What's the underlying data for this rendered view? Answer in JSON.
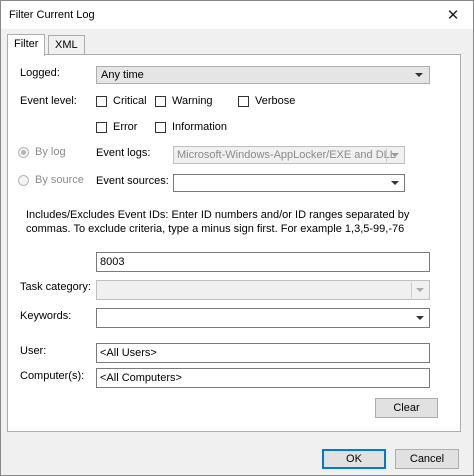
{
  "window": {
    "title": "Filter Current Log",
    "close_glyph": "✕"
  },
  "tabs": [
    {
      "label": "Filter"
    },
    {
      "label": "XML"
    }
  ],
  "logged": {
    "label": "Logged:",
    "value": "Any time"
  },
  "event_level": {
    "label": "Event level:",
    "options": [
      {
        "label": "Critical",
        "checked": false
      },
      {
        "label": "Warning",
        "checked": false
      },
      {
        "label": "Verbose",
        "checked": false
      },
      {
        "label": "Error",
        "checked": false
      },
      {
        "label": "Information",
        "checked": false
      }
    ]
  },
  "by_log": {
    "label": "By log",
    "selected": true
  },
  "by_source": {
    "label": "By source",
    "selected": false
  },
  "event_logs": {
    "label": "Event logs:",
    "value": "Microsoft-Windows-AppLocker/EXE and DLL"
  },
  "event_sources": {
    "label": "Event sources:",
    "value": ""
  },
  "event_ids": {
    "help": "Includes/Excludes Event IDs: Enter ID numbers and/or ID ranges separated by commas. To exclude criteria, type a minus sign first. For example 1,3,5-99,-76",
    "value": "8003"
  },
  "task_category": {
    "label": "Task category:",
    "value": ""
  },
  "keywords": {
    "label": "Keywords:",
    "value": ""
  },
  "user": {
    "label": "User:",
    "value": "<All Users>"
  },
  "computer": {
    "label": "Computer(s):",
    "value": "<All Computers>"
  },
  "buttons": {
    "clear": "Clear",
    "ok": "OK",
    "cancel": "Cancel"
  }
}
